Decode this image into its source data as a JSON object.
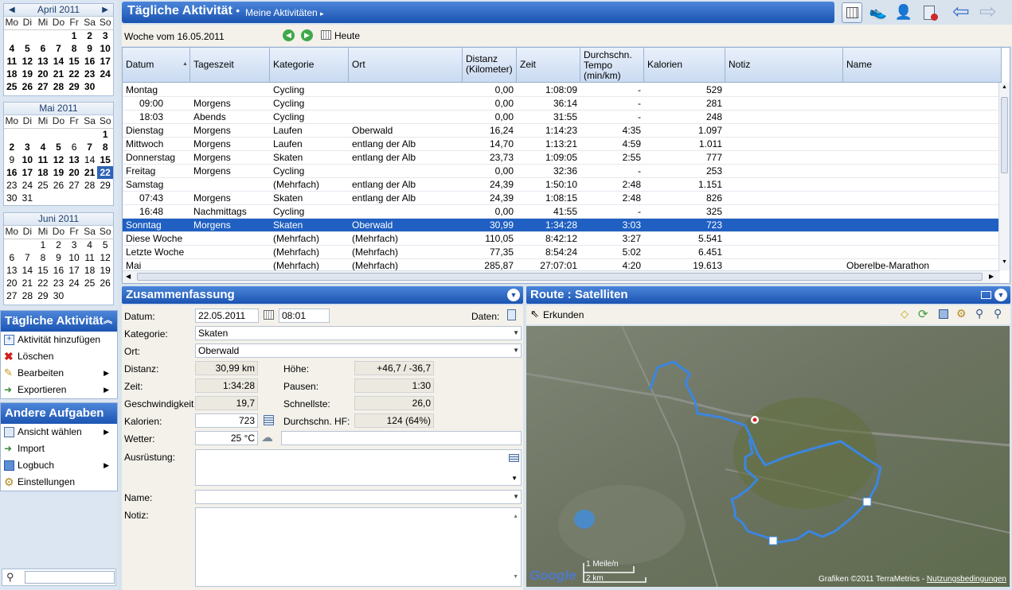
{
  "calendars": [
    {
      "title": "April 2011",
      "dow": [
        "Mo",
        "Di",
        "Mi",
        "Do",
        "Fr",
        "Sa",
        "So"
      ],
      "weeks": [
        [
          "",
          "",
          "",
          "",
          "1",
          "2",
          "3"
        ],
        [
          "4",
          "5",
          "6",
          "7",
          "8",
          "9",
          "10"
        ],
        [
          "11",
          "12",
          "13",
          "14",
          "15",
          "16",
          "17"
        ],
        [
          "18",
          "19",
          "20",
          "21",
          "22",
          "23",
          "24"
        ],
        [
          "25",
          "26",
          "27",
          "28",
          "29",
          "30",
          ""
        ]
      ]
    },
    {
      "title": "Mai 2011",
      "dow": [
        "Mo",
        "Di",
        "Mi",
        "Do",
        "Fr",
        "Sa",
        "So"
      ],
      "weeks": [
        [
          "",
          "",
          "",
          "",
          "",
          "",
          "1"
        ],
        [
          "2",
          "3",
          "4",
          "5",
          "6",
          "7",
          "8"
        ],
        [
          "9",
          "10",
          "11",
          "12",
          "13",
          "14",
          "15"
        ],
        [
          "16",
          "17",
          "18",
          "19",
          "20",
          "21",
          "22"
        ],
        [
          "23",
          "24",
          "25",
          "26",
          "27",
          "28",
          "29"
        ],
        [
          "30",
          "31",
          "",
          "",
          "",
          "",
          ""
        ]
      ]
    },
    {
      "title": "Juni 2011",
      "dow": [
        "Mo",
        "Di",
        "Mi",
        "Do",
        "Fr",
        "Sa",
        "So"
      ],
      "weeks": [
        [
          "",
          "",
          "1",
          "2",
          "3",
          "4",
          "5"
        ],
        [
          "6",
          "7",
          "8",
          "9",
          "10",
          "11",
          "12"
        ],
        [
          "13",
          "14",
          "15",
          "16",
          "17",
          "18",
          "19"
        ],
        [
          "20",
          "21",
          "22",
          "23",
          "24",
          "25",
          "26"
        ],
        [
          "27",
          "28",
          "29",
          "30",
          "",
          "",
          ""
        ]
      ]
    }
  ],
  "tasks": {
    "title": "Tägliche Aktivität",
    "items": [
      "Aktivität hinzufügen",
      "Löschen",
      "Bearbeiten",
      "Exportieren"
    ]
  },
  "other_tasks": {
    "title": "Andere Aufgaben",
    "items": [
      "Ansicht wählen",
      "Import",
      "Logbuch",
      "Einstellungen"
    ]
  },
  "header": {
    "title": "Tägliche Aktivität",
    "bullet": "•",
    "breadcrumb": "Meine Aktivitäten"
  },
  "week": {
    "label": "Woche vom 16.05.2011",
    "today": "Heute"
  },
  "grid": {
    "columns": [
      "Datum",
      "Tageszeit",
      "Kategorie",
      "Ort",
      "Distanz (Kilometer)",
      "Zeit",
      "Durchschn. Tempo (min/km)",
      "Kalorien",
      "Notiz",
      "Name"
    ],
    "rows": [
      [
        "Montag",
        "",
        "Cycling",
        "",
        "0,00",
        "1:08:09",
        "-",
        "529",
        "",
        ""
      ],
      [
        "09:00",
        "Morgens",
        "Cycling",
        "",
        "0,00",
        "36:14",
        "-",
        "281",
        "",
        ""
      ],
      [
        "18:03",
        "Abends",
        "Cycling",
        "",
        "0,00",
        "31:55",
        "-",
        "248",
        "",
        ""
      ],
      [
        "Dienstag",
        "Morgens",
        "Laufen",
        "Oberwald",
        "16,24",
        "1:14:23",
        "4:35",
        "1.097",
        "",
        ""
      ],
      [
        "Mittwoch",
        "Morgens",
        "Laufen",
        "entlang der Alb",
        "14,70",
        "1:13:21",
        "4:59",
        "1.011",
        "",
        ""
      ],
      [
        "Donnerstag",
        "Morgens",
        "Skaten",
        "entlang der Alb",
        "23,73",
        "1:09:05",
        "2:55",
        "777",
        "",
        ""
      ],
      [
        "Freitag",
        "Morgens",
        "Cycling",
        "",
        "0,00",
        "32:36",
        "-",
        "253",
        "",
        ""
      ],
      [
        "Samstag",
        "",
        "(Mehrfach)",
        "entlang der Alb",
        "24,39",
        "1:50:10",
        "2:48",
        "1.151",
        "",
        ""
      ],
      [
        "07:43",
        "Morgens",
        "Skaten",
        "entlang der Alb",
        "24,39",
        "1:08:15",
        "2:48",
        "826",
        "",
        ""
      ],
      [
        "16:48",
        "Nachmittags",
        "Cycling",
        "",
        "0,00",
        "41:55",
        "-",
        "325",
        "",
        ""
      ],
      [
        "Sonntag",
        "Morgens",
        "Skaten",
        "Oberwald",
        "30,99",
        "1:34:28",
        "3:03",
        "723",
        "",
        ""
      ],
      [
        "Diese Woche",
        "",
        "(Mehrfach)",
        "(Mehrfach)",
        "110,05",
        "8:42:12",
        "3:27",
        "5.541",
        "",
        ""
      ],
      [
        "Letzte Woche",
        "",
        "(Mehrfach)",
        "(Mehrfach)",
        "77,35",
        "8:54:24",
        "5:02",
        "6.451",
        "",
        ""
      ],
      [
        "Mai",
        "",
        "(Mehrfach)",
        "(Mehrfach)",
        "285,87",
        "27:07:01",
        "4:20",
        "19.613",
        "",
        "Oberelbe-Marathon"
      ]
    ]
  },
  "summary": {
    "title": "Zusammenfassung",
    "datum_label": "Datum:",
    "datum": "22.05.2011",
    "time": "08:01",
    "daten_label": "Daten:",
    "kategorie_label": "Kategorie:",
    "kategorie": "Skaten",
    "ort_label": "Ort:",
    "ort": "Oberwald",
    "distanz_label": "Distanz:",
    "distanz": "30,99 km",
    "hoehe_label": "Höhe:",
    "hoehe": "+46,7 / -36,7",
    "zeit_label": "Zeit:",
    "zeit": "1:34:28",
    "pausen_label": "Pausen:",
    "pausen": "1:30",
    "geschw_label": "Geschwindigkeit",
    "geschw": "19,7",
    "schnellste_label": "Schnellste:",
    "schnellste": "26,0",
    "kalorien_label": "Kalorien:",
    "kalorien": "723",
    "hf_label": "Durchschn. HF:",
    "hf": "124 (64%)",
    "wetter_label": "Wetter:",
    "wetter": "25 °C",
    "ausruestung_label": "Ausrüstung:",
    "name_label": "Name:",
    "notiz_label": "Notiz:"
  },
  "route": {
    "title": "Route : Satelliten",
    "explore": "Erkunden",
    "scale_mi": "1 Meile/n",
    "scale_km": "2 km",
    "google": "Google",
    "credits": "Grafiken ©2011 TerraMetrics -",
    "terms": "Nutzungsbedingungen"
  },
  "colors": {
    "accent": "#1a53b1",
    "selection": "#2060c2",
    "route": "#3b86e0"
  }
}
